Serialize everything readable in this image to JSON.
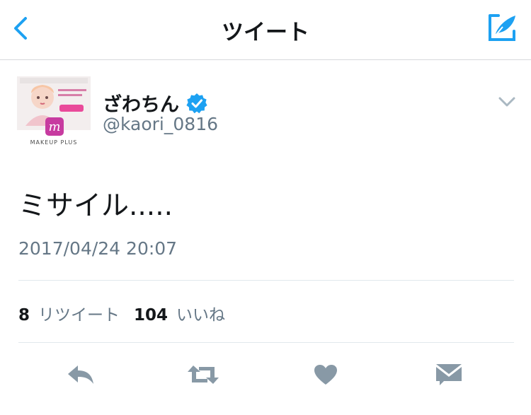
{
  "header": {
    "title": "ツイート",
    "back_icon": "chevron-left-icon",
    "compose_icon": "compose-tweet-icon",
    "accent": "#1da1f2"
  },
  "author": {
    "display_name": "ざわちん",
    "handle": "@kaori_0816",
    "verified": true,
    "avatar": {
      "caption": "MAKEUP PLUS",
      "badge": "m"
    }
  },
  "tweet": {
    "text": "ミサイル.....",
    "timestamp": "2017/04/24 20:07"
  },
  "stats": {
    "retweets": "8",
    "retweets_label": "リツイート",
    "likes": "104",
    "likes_label": "いいね"
  },
  "actions": {
    "reply_icon": "reply-icon",
    "retweet_icon": "retweet-icon",
    "like_icon": "heart-icon",
    "dm_icon": "envelope-icon"
  },
  "colors": {
    "text_primary": "#14171a",
    "text_secondary": "#657786",
    "icon_gray": "#8899a6",
    "divider": "#e1e8ed"
  }
}
